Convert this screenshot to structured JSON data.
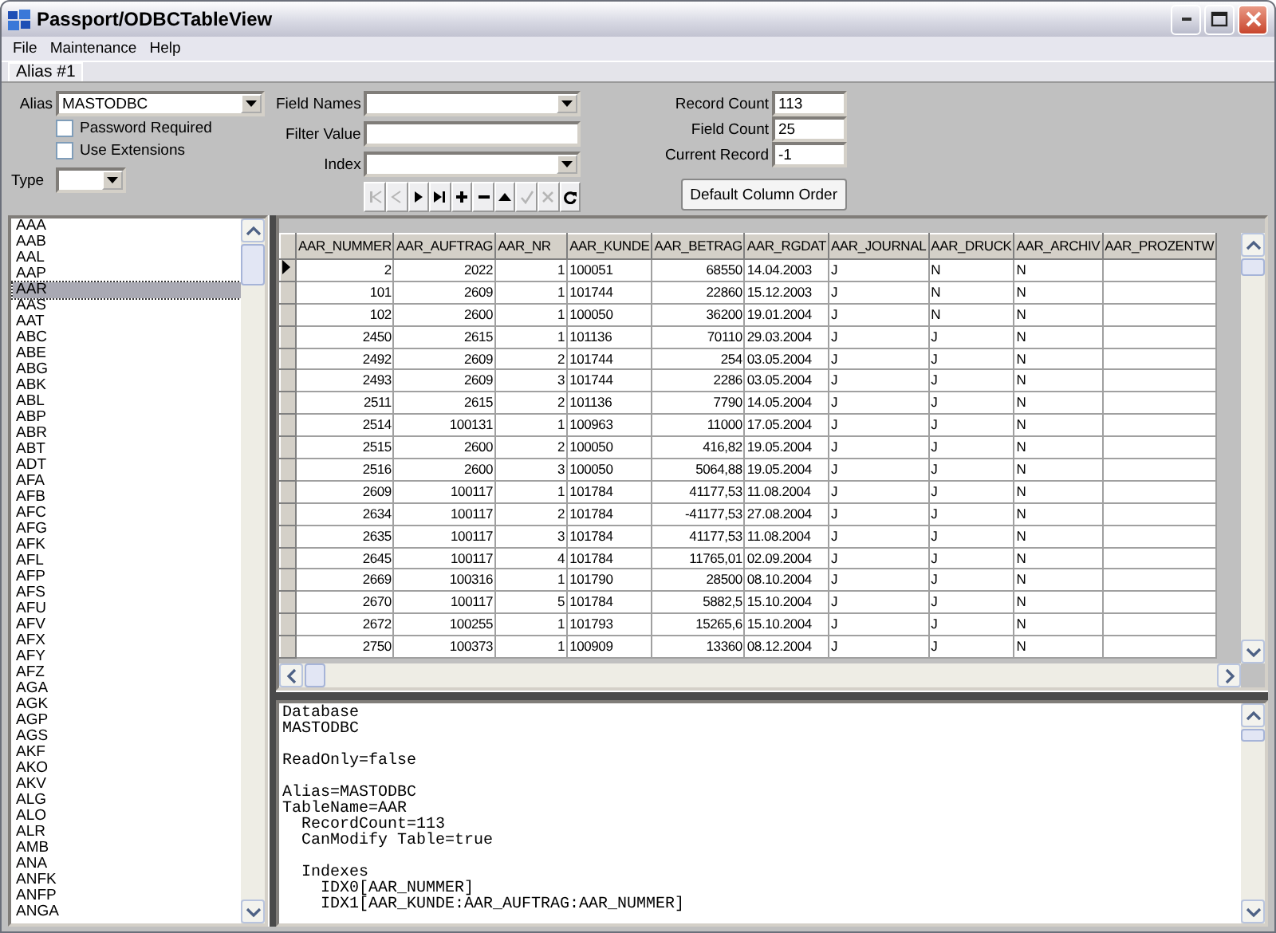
{
  "window": {
    "title": "Passport/ODBCTableView"
  },
  "menu": [
    "File",
    "Maintenance",
    "Help"
  ],
  "tabs": [
    {
      "label": "Alias #1",
      "selected": true
    }
  ],
  "form": {
    "alias": {
      "label": "Alias",
      "value": "MASTODBC"
    },
    "password_required": {
      "label": "Password Required",
      "checked": false
    },
    "use_extensions": {
      "label": "Use Extensions",
      "checked": false
    },
    "type": {
      "label": "Type"
    },
    "field_names": {
      "label": "Field Names"
    },
    "filter_value": {
      "label": "Filter Value"
    },
    "index": {
      "label": "Index"
    },
    "record_count": {
      "label": "Record Count",
      "value": "113"
    },
    "field_count": {
      "label": "Field Count",
      "value": "25"
    },
    "current_record": {
      "label": "Current Record",
      "value": "-1"
    },
    "default_column_order": "Default Column Order"
  },
  "navigator": [
    {
      "kind": "first",
      "disabled": true
    },
    {
      "kind": "prior",
      "disabled": true
    },
    {
      "kind": "next",
      "disabled": false
    },
    {
      "kind": "last",
      "disabled": false
    },
    {
      "kind": "insert",
      "disabled": false
    },
    {
      "kind": "delete",
      "disabled": false
    },
    {
      "kind": "edit",
      "disabled": false
    },
    {
      "kind": "post",
      "disabled": true
    },
    {
      "kind": "cancel",
      "disabled": true
    },
    {
      "kind": "refresh",
      "disabled": false
    }
  ],
  "tables": [
    {
      "name": "AAA",
      "selected": false
    },
    {
      "name": "AAB",
      "selected": false
    },
    {
      "name": "AAL",
      "selected": false
    },
    {
      "name": "AAP",
      "selected": false
    },
    {
      "name": "AAR",
      "selected": true
    },
    {
      "name": "AAS",
      "selected": false
    },
    {
      "name": "AAT",
      "selected": false
    },
    {
      "name": "ABC",
      "selected": false
    },
    {
      "name": "ABE",
      "selected": false
    },
    {
      "name": "ABG",
      "selected": false
    },
    {
      "name": "ABK",
      "selected": false
    },
    {
      "name": "ABL",
      "selected": false
    },
    {
      "name": "ABP",
      "selected": false
    },
    {
      "name": "ABR",
      "selected": false
    },
    {
      "name": "ABT",
      "selected": false
    },
    {
      "name": "ADT",
      "selected": false
    },
    {
      "name": "AFA",
      "selected": false
    },
    {
      "name": "AFB",
      "selected": false
    },
    {
      "name": "AFC",
      "selected": false
    },
    {
      "name": "AFG",
      "selected": false
    },
    {
      "name": "AFK",
      "selected": false
    },
    {
      "name": "AFL",
      "selected": false
    },
    {
      "name": "AFP",
      "selected": false
    },
    {
      "name": "AFS",
      "selected": false
    },
    {
      "name": "AFU",
      "selected": false
    },
    {
      "name": "AFV",
      "selected": false
    },
    {
      "name": "AFX",
      "selected": false
    },
    {
      "name": "AFY",
      "selected": false
    },
    {
      "name": "AFZ",
      "selected": false
    },
    {
      "name": "AGA",
      "selected": false
    },
    {
      "name": "AGK",
      "selected": false
    },
    {
      "name": "AGP",
      "selected": false
    },
    {
      "name": "AGS",
      "selected": false
    },
    {
      "name": "AKF",
      "selected": false
    },
    {
      "name": "AKO",
      "selected": false
    },
    {
      "name": "AKV",
      "selected": false
    },
    {
      "name": "ALG",
      "selected": false
    },
    {
      "name": "ALO",
      "selected": false
    },
    {
      "name": "ALR",
      "selected": false
    },
    {
      "name": "AMB",
      "selected": false
    },
    {
      "name": "ANA",
      "selected": false
    },
    {
      "name": "ANFK",
      "selected": false
    },
    {
      "name": "ANFP",
      "selected": false
    },
    {
      "name": "ANGA",
      "selected": false
    }
  ],
  "grid": {
    "columns": [
      {
        "label": "AAR_NUMMER",
        "kind": "numeric"
      },
      {
        "label": "AAR_AUFTRAG",
        "kind": "numeric"
      },
      {
        "label": "AAR_NR",
        "kind": "numeric"
      },
      {
        "label": "AAR_KUNDE",
        "kind": "string"
      },
      {
        "label": "AAR_BETRAG",
        "kind": "numeric"
      },
      {
        "label": "AAR_RGDAT",
        "kind": "string"
      },
      {
        "label": "AAR_JOURNAL",
        "kind": "string"
      },
      {
        "label": "AAR_DRUCK",
        "kind": "string"
      },
      {
        "label": "AAR_ARCHIV",
        "kind": "string"
      },
      {
        "label": "AAR_PROZENTW",
        "kind": "string"
      }
    ],
    "rows": [
      {
        "current": true,
        "cells": [
          "2",
          "2022",
          "1",
          "100051",
          "68550",
          "14.04.2003",
          "J",
          "N",
          "N"
        ]
      },
      {
        "current": false,
        "cells": [
          "101",
          "2609",
          "1",
          "101744",
          "22860",
          "15.12.2003",
          "J",
          "N",
          "N"
        ]
      },
      {
        "current": false,
        "cells": [
          "102",
          "2600",
          "1",
          "100050",
          "36200",
          "19.01.2004",
          "J",
          "N",
          "N"
        ]
      },
      {
        "current": false,
        "cells": [
          "2450",
          "2615",
          "1",
          "101136",
          "70110",
          "29.03.2004",
          "J",
          "J",
          "N"
        ]
      },
      {
        "current": false,
        "cells": [
          "2492",
          "2609",
          "2",
          "101744",
          "254",
          "03.05.2004",
          "J",
          "J",
          "N"
        ]
      },
      {
        "current": false,
        "cells": [
          "2493",
          "2609",
          "3",
          "101744",
          "2286",
          "03.05.2004",
          "J",
          "J",
          "N"
        ]
      },
      {
        "current": false,
        "cells": [
          "2511",
          "2615",
          "2",
          "101136",
          "7790",
          "14.05.2004",
          "J",
          "J",
          "N"
        ]
      },
      {
        "current": false,
        "cells": [
          "2514",
          "100131",
          "1",
          "100963",
          "11000",
          "17.05.2004",
          "J",
          "J",
          "N"
        ]
      },
      {
        "current": false,
        "cells": [
          "2515",
          "2600",
          "2",
          "100050",
          "416,82",
          "19.05.2004",
          "J",
          "J",
          "N"
        ]
      },
      {
        "current": false,
        "cells": [
          "2516",
          "2600",
          "3",
          "100050",
          "5064,88",
          "19.05.2004",
          "J",
          "J",
          "N"
        ]
      },
      {
        "current": false,
        "cells": [
          "2609",
          "100117",
          "1",
          "101784",
          "41177,53",
          "11.08.2004",
          "J",
          "J",
          "N"
        ]
      },
      {
        "current": false,
        "cells": [
          "2634",
          "100117",
          "2",
          "101784",
          "-41177,53",
          "27.08.2004",
          "J",
          "J",
          "N"
        ]
      },
      {
        "current": false,
        "cells": [
          "2635",
          "100117",
          "3",
          "101784",
          "41177,53",
          "11.08.2004",
          "J",
          "J",
          "N"
        ]
      },
      {
        "current": false,
        "cells": [
          "2645",
          "100117",
          "4",
          "101784",
          "11765,01",
          "02.09.2004",
          "J",
          "J",
          "N"
        ]
      },
      {
        "current": false,
        "cells": [
          "2669",
          "100316",
          "1",
          "101790",
          "28500",
          "08.10.2004",
          "J",
          "J",
          "N"
        ]
      },
      {
        "current": false,
        "cells": [
          "2670",
          "100117",
          "5",
          "101784",
          "5882,5",
          "15.10.2004",
          "J",
          "J",
          "N"
        ]
      },
      {
        "current": false,
        "cells": [
          "2672",
          "100255",
          "1",
          "101793",
          "15265,6",
          "15.10.2004",
          "J",
          "J",
          "N"
        ]
      },
      {
        "current": false,
        "cells": [
          "2750",
          "100373",
          "1",
          "100909",
          "13360",
          "08.12.2004",
          "J",
          "J",
          "N"
        ]
      }
    ]
  },
  "memo": {
    "blocks": [
      [
        "Database",
        "MASTODBC"
      ],
      [
        "ReadOnly=false"
      ],
      [
        "Alias=MASTODBC",
        "TableName=AAR",
        "  RecordCount=113",
        "  CanModify Table=true"
      ],
      [
        "  Indexes",
        "    IDX0[AAR_NUMMER]",
        "    IDX1[AAR_KUNDE:AAR_AUFTRAG:AAR_NUMMER]"
      ]
    ]
  }
}
